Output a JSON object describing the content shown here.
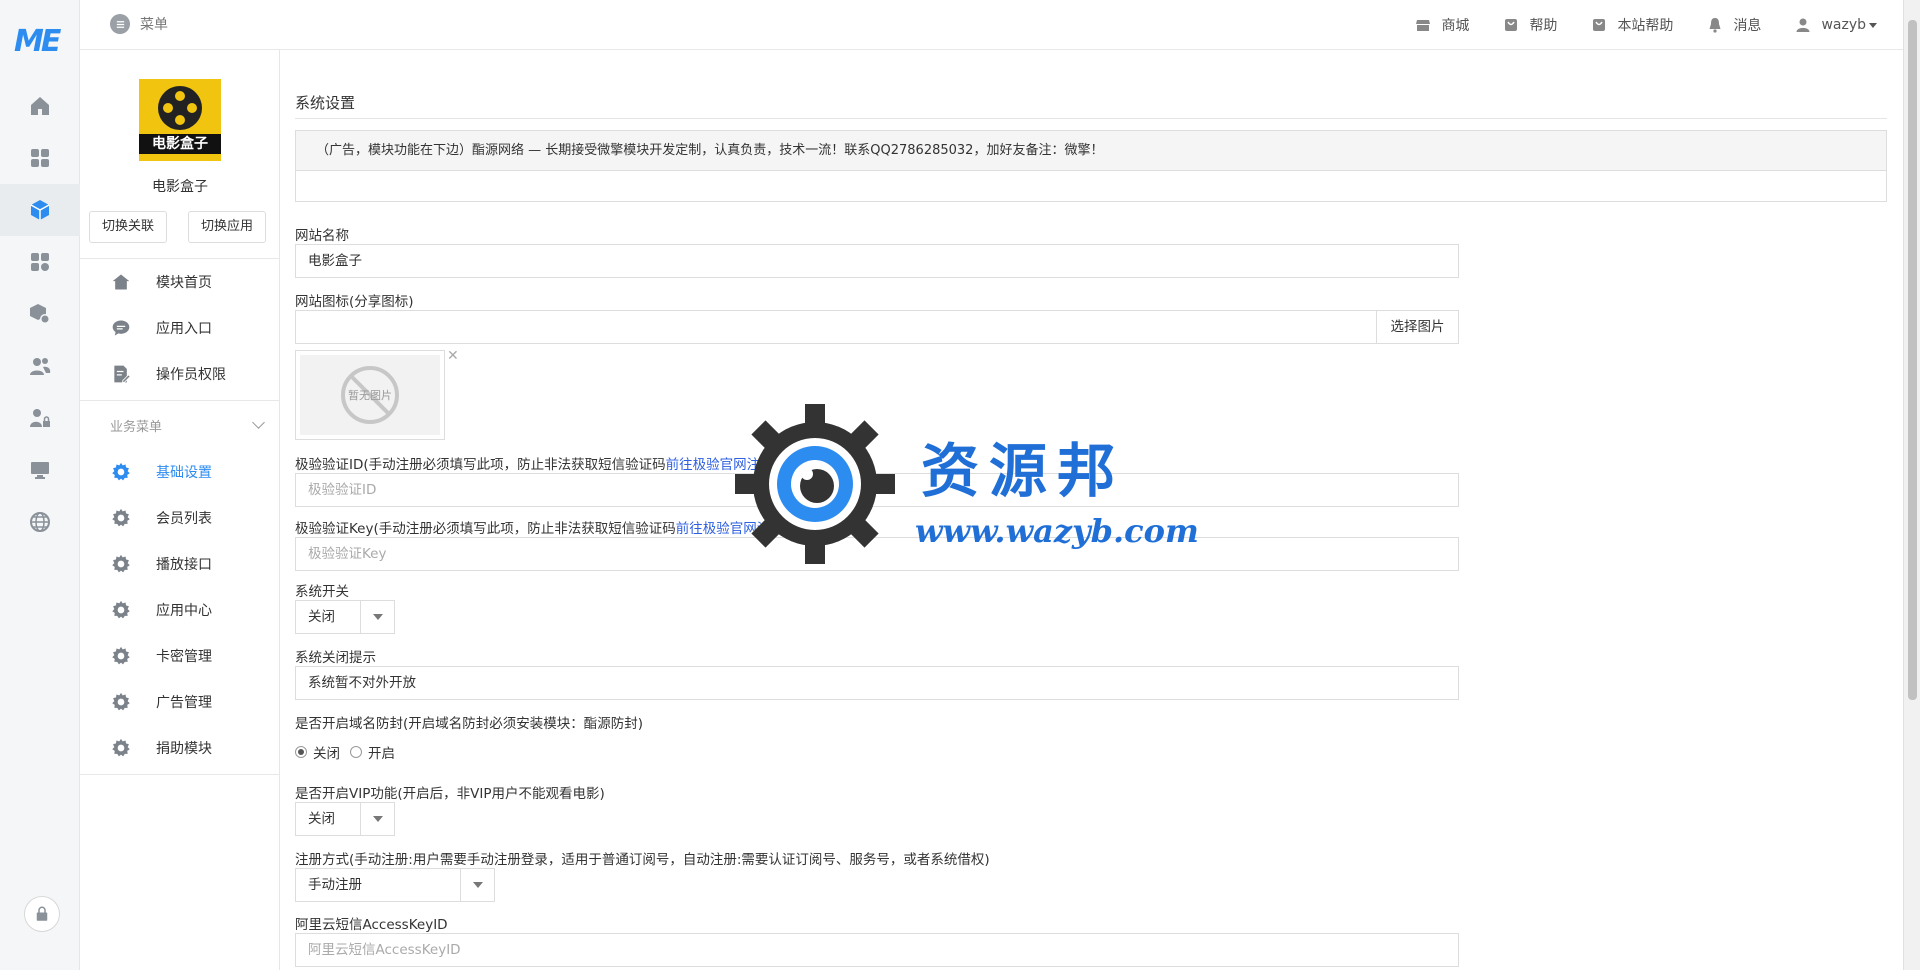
{
  "topbar": {
    "menu_label": "菜单",
    "links": {
      "shop": "商城",
      "help": "帮助",
      "site_help": "本站帮助",
      "messages": "消息",
      "user": "wazyb"
    }
  },
  "rail": {
    "logo": "ME",
    "icons": [
      "home-icon",
      "apps-icon",
      "module-cube-icon",
      "app-grid-plus-icon",
      "package-settings-icon",
      "users-icon",
      "user-lock-icon",
      "monitor-icon",
      "globe-icon",
      "lock-icon"
    ]
  },
  "sidebar": {
    "module_logo_caption": "电影盒子",
    "module_name": "电影盒子",
    "switch_link": "切换关联",
    "switch_app": "切换应用",
    "top_items": [
      {
        "label": "模块首页",
        "icon": "home-icon"
      },
      {
        "label": "应用入口",
        "icon": "chat-bubble-icon"
      },
      {
        "label": "操作员权限",
        "icon": "document-edit-icon"
      }
    ],
    "section_title": "业务菜单",
    "business_items": [
      {
        "label": "基础设置",
        "icon": "gear-icon",
        "active": true
      },
      {
        "label": "会员列表",
        "icon": "gear-icon"
      },
      {
        "label": "播放接口",
        "icon": "gear-icon"
      },
      {
        "label": "应用中心",
        "icon": "gear-icon"
      },
      {
        "label": "卡密管理",
        "icon": "gear-icon"
      },
      {
        "label": "广告管理",
        "icon": "gear-icon"
      },
      {
        "label": "捐助模块",
        "icon": "gear-icon"
      }
    ]
  },
  "main": {
    "page_title": "系统设置",
    "ad_text": "（广告，模块功能在下边）酯源网络 — 长期接受微擎模块开发定制，认真负责，技术一流！联系QQ2786285032，加好友备注：微擎！",
    "site_name": {
      "label": "网站名称",
      "value": "电影盒子"
    },
    "site_icon": {
      "label": "网站图标(分享图标)",
      "value": "",
      "button": "选择图片",
      "empty_image": "暂无图片"
    },
    "geetest_id": {
      "label": "极验验证ID(手动注册必须填写此项，防止非法获取短信验证码",
      "link": "前往极验官网注册ID",
      "suffix": ")",
      "placeholder": "极验验证ID"
    },
    "geetest_key": {
      "label": "极验验证Key(手动注册必须填写此项，防止非法获取短信验证码",
      "link": "前往极验官网注册ID",
      "suffix": ")",
      "placeholder": "极验验证Key"
    },
    "system_switch": {
      "label": "系统开关",
      "value": "关闭"
    },
    "close_tip": {
      "label": "系统关闭提示",
      "value": "系统暂不对外开放"
    },
    "domain_block": {
      "label": "是否开启域名防封(开启域名防封必须安装模块：酯源防封)",
      "options": [
        "关闭",
        "开启"
      ],
      "selected": "关闭"
    },
    "vip": {
      "label": "是否开启VIP功能(开启后，非VIP用户不能观看电影)",
      "value": "关闭"
    },
    "register_mode": {
      "label": "注册方式(手动注册:用户需要手动注册登录，适用于普通订阅号，自动注册:需要认证订阅号、服务号，或者系统借权)",
      "value": "手动注册"
    },
    "aliyun_key": {
      "label": "阿里云短信AccessKeyID",
      "placeholder": "阿里云短信AccessKeyID"
    }
  },
  "watermark": {
    "title": "资源邦",
    "url": "www.wazyb.com"
  },
  "colors": {
    "accent": "#2d8cf0",
    "link": "#2d5fe0",
    "watermark_blue": "#1f6fd6"
  }
}
